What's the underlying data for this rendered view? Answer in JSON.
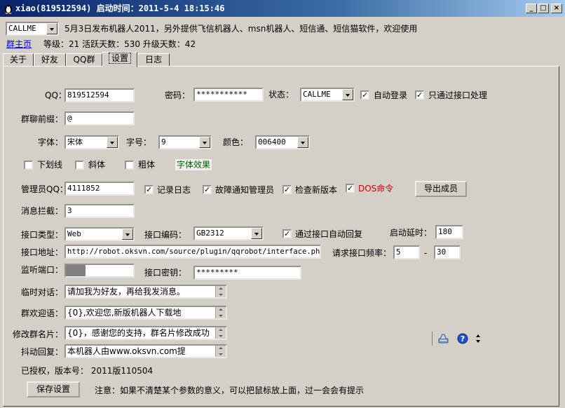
{
  "window": {
    "title": "xiao(819512594) 启动时间：2011-5-4 18:15:46",
    "min": "_",
    "max": "□",
    "close": "×"
  },
  "top": {
    "status_value": "CALLME",
    "announce": "5月3日发布机器人2011，另外提供飞信机器人、msn机器人、短信通、短信猫软件，欢迎使用",
    "home_link": "群主页",
    "stats": "等级：21  活跃天数：530  升级天数：42"
  },
  "tabs": [
    "关于",
    "好友",
    "QQ群",
    "设置",
    "日志"
  ],
  "form": {
    "qq_label": "QQ：",
    "qq_value": "819512594",
    "pwd_label": "密码：",
    "pwd_value": "***********",
    "status_label": "状态：",
    "status_value": "CALLME",
    "autologin": "自动登录",
    "only_api": "只通过接口处理",
    "prefix_label": "群聊前缀：",
    "prefix_value": "@",
    "font_label": "字体：",
    "font_value": "宋体",
    "size_label": "字号：",
    "size_value": "9",
    "color_label": "颜色：",
    "color_value": "006400",
    "underline": "下划线",
    "italic": "斜体",
    "bold": "粗体",
    "font_effect": "字体效果",
    "admin_label": "管理员QQ：",
    "admin_value": "4111852",
    "log_record": "记录日志",
    "notify_admin": "故障通知管理员",
    "check_version": "检查新版本",
    "dos_cmd": "DOS命令",
    "export_btn": "导出成员",
    "intercept_label": "消息拦截：",
    "intercept_value": "3",
    "api_type_label": "接口类型：",
    "api_type_value": "Web",
    "api_enc_label": "接口编码：",
    "api_enc_value": "GB2312",
    "auto_reply": "通过接口自动回复",
    "delay_label": "启动延时：",
    "delay_value": "180",
    "api_url_label": "接口地址：",
    "api_url_value": "http://robot.oksvn.com/source/plugin/qqrobot/interface.php",
    "freq_label": "请求接口频率：",
    "freq_from": "5",
    "freq_sep": "-",
    "freq_to": "30",
    "port_label": "监听端口：",
    "key_label": "接口密钥：",
    "key_value": "*********",
    "temp_label": "临时对话：",
    "temp_value": "请加我为好友，再给我发消息。",
    "welcome_label": "群欢迎语：",
    "welcome_value": "{0},欢迎您,新版机器人下载地",
    "card_label": "修改群名片：",
    "card_value": "{0}，感谢您的支持，群名片修改成功",
    "shake_label": "抖动回复：",
    "shake_value": "本机器人由www.oksvn.com提",
    "version": "已授权，版本号：  2011版110504",
    "save_btn": "保存设置",
    "note": "注意：如果不清楚某个参数的意义，可以把鼠标放上面，过一会会有提示"
  },
  "colors": {
    "font_effect": "#006400",
    "dos": "#cc0000"
  }
}
